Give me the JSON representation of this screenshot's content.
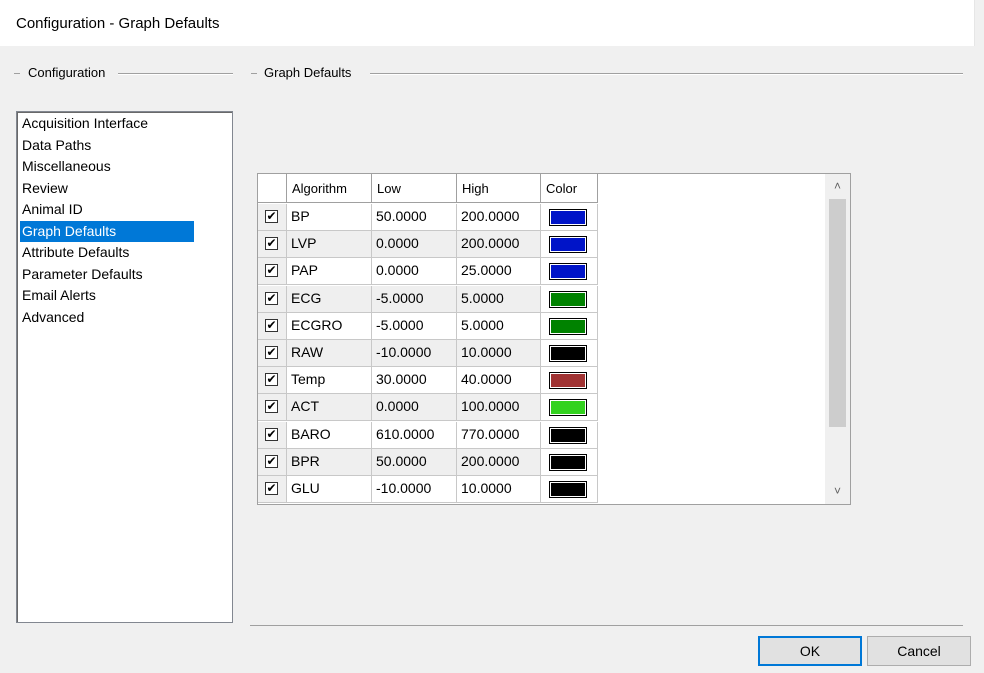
{
  "window": {
    "title": "Configuration - Graph Defaults"
  },
  "config_group": {
    "label": "Configuration"
  },
  "graph_group": {
    "label": "Graph Defaults"
  },
  "sidebar": {
    "selected": "Graph Defaults",
    "items": [
      {
        "label": "Acquisition Interface"
      },
      {
        "label": "Data Paths"
      },
      {
        "label": "Miscellaneous"
      },
      {
        "label": "Review"
      },
      {
        "label": "Animal ID"
      },
      {
        "label": "Graph Defaults"
      },
      {
        "label": "Attribute Defaults"
      },
      {
        "label": "Parameter Defaults"
      },
      {
        "label": "Email Alerts"
      },
      {
        "label": "Advanced"
      }
    ]
  },
  "grid": {
    "columns": [
      "",
      "Algorithm",
      "Low",
      "High",
      "Color"
    ],
    "rows": [
      {
        "checked": true,
        "algorithm": "BP",
        "low": "50.0000",
        "high": "200.0000",
        "color": "#0014c8"
      },
      {
        "checked": true,
        "algorithm": "LVP",
        "low": "0.0000",
        "high": "200.0000",
        "color": "#0014c8"
      },
      {
        "checked": true,
        "algorithm": "PAP",
        "low": "0.0000",
        "high": "25.0000",
        "color": "#0014c8"
      },
      {
        "checked": true,
        "algorithm": "ECG",
        "low": "-5.0000",
        "high": "5.0000",
        "color": "#008200"
      },
      {
        "checked": true,
        "algorithm": "ECGRO",
        "low": "-5.0000",
        "high": "5.0000",
        "color": "#008200"
      },
      {
        "checked": true,
        "algorithm": "RAW",
        "low": "-10.0000",
        "high": "10.0000",
        "color": "#000000"
      },
      {
        "checked": true,
        "algorithm": "Temp",
        "low": "30.0000",
        "high": "40.0000",
        "color": "#a03232"
      },
      {
        "checked": true,
        "algorithm": "ACT",
        "low": "0.0000",
        "high": "100.0000",
        "color": "#32d21e"
      },
      {
        "checked": true,
        "algorithm": "BARO",
        "low": "610.0000",
        "high": "770.0000",
        "color": "#000000"
      },
      {
        "checked": true,
        "algorithm": "BPR",
        "low": "50.0000",
        "high": "200.0000",
        "color": "#000000"
      },
      {
        "checked": true,
        "algorithm": "GLU",
        "low": "-10.0000",
        "high": "10.0000",
        "color": "#000000"
      }
    ]
  },
  "icons": {
    "scroll_up": "chevron-up-icon",
    "scroll_down": "chevron-down-icon",
    "check": "checkmark-icon"
  },
  "buttons": {
    "ok": "OK",
    "cancel": "Cancel"
  }
}
